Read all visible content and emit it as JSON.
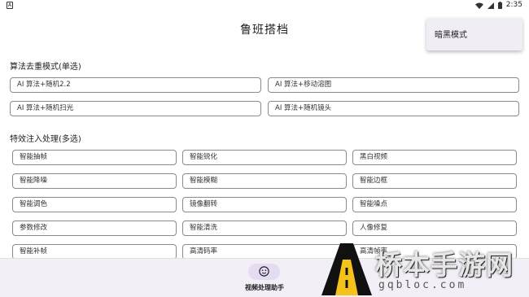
{
  "status_bar": {
    "left_icon": "A",
    "time": "2:35"
  },
  "app_title": "鲁班搭档",
  "menu": {
    "items": [
      "暗黑模式"
    ]
  },
  "section_algorithm": {
    "title": "算法去重模式(单选)",
    "options": [
      "AI 算法+随机2.2",
      "AI 算法+移动溶图",
      "AI 算法+随机扫光",
      "AI 算法+随机镜头"
    ]
  },
  "section_effects": {
    "title": "特效注入处理(多选)",
    "options": [
      "智能抽帧",
      "智能锐化",
      "黑白视频",
      "智能降噪",
      "智能模糊",
      "智能边框",
      "智能调色",
      "镜像翻转",
      "智能噪点",
      "参数修改",
      "智能清洗",
      "人像修复",
      "智能补帧",
      "高清码率",
      "高清帧率"
    ]
  },
  "bottom_nav": {
    "items": [
      {
        "label": "视频处理助手",
        "icon": "smiley-icon"
      }
    ]
  },
  "watermark": {
    "title": "桥本手游网",
    "url": "gqbloc.com"
  },
  "colors": {
    "accent_pill": "#e5dcf2",
    "nav_background": "#f3eff6",
    "menu_background": "#f1edf4",
    "button_border": "#8a8a8a"
  }
}
